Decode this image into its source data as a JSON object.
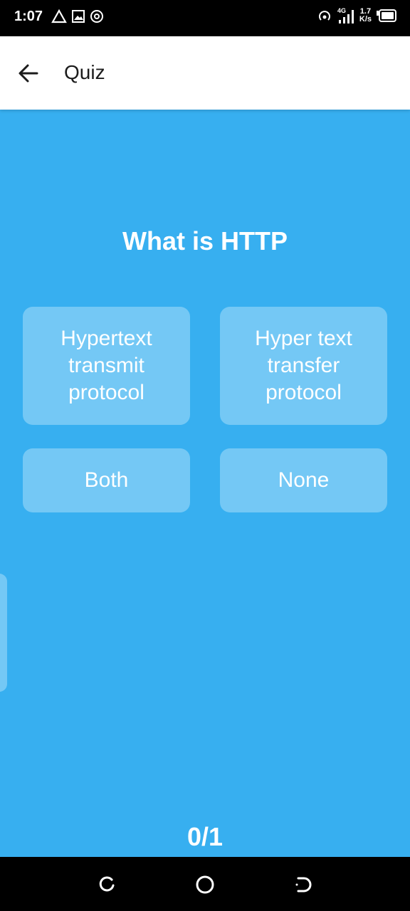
{
  "status_bar": {
    "time": "1:07",
    "network": "4G",
    "speed_value": "1.7",
    "speed_unit": "K/s",
    "left_icons": [
      "drive-icon",
      "gallery-icon",
      "hotspot-icon"
    ],
    "right_icons": [
      "hotspot-icon",
      "signal-icon",
      "battery-icon"
    ]
  },
  "app_bar": {
    "title": "Quiz",
    "back_icon": "arrow-left-icon"
  },
  "quiz": {
    "question": "What is HTTP",
    "options": [
      {
        "lines": [
          "Hypertext",
          "transmit",
          "protocol"
        ]
      },
      {
        "lines": [
          "Hyper text",
          "transfer",
          "protocol"
        ]
      },
      {
        "lines": [
          "Both"
        ]
      },
      {
        "lines": [
          "None"
        ]
      }
    ],
    "progress": "0/1"
  },
  "colors": {
    "background": "#37aff0",
    "option_bg": "#74c8f5",
    "app_bar": "#ffffff"
  },
  "nav_bar": {
    "buttons": [
      "recents-icon",
      "home-icon",
      "back-nav-icon"
    ]
  }
}
